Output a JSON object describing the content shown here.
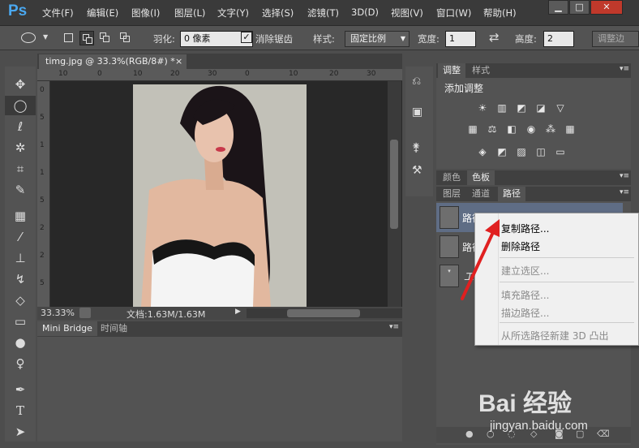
{
  "app": {
    "logo": "Ps"
  },
  "menu": [
    "文件(F)",
    "编辑(E)",
    "图像(I)",
    "图层(L)",
    "文字(Y)",
    "选择(S)",
    "滤镜(T)",
    "3D(D)",
    "视图(V)",
    "窗口(W)",
    "帮助(H)"
  ],
  "window_buttons": {
    "minimize": "▁",
    "restore": "□",
    "close": "✕"
  },
  "options": {
    "feather_label": "羽化:",
    "feather_value": "0 像素",
    "antialias_label": "消除锯齿",
    "style_label": "样式:",
    "style_value": "固定比例",
    "width_label": "宽度:",
    "width_value": "1",
    "height_label": "高度:",
    "height_value": "2",
    "refine_label": "调整边"
  },
  "document": {
    "tab_title": "timg.jpg @ 33.3%(RGB/8#) *",
    "close_glyph": "×",
    "zoom": "33.33%",
    "doc_info": "文档:1.63M/1.63M",
    "ruler_top": [
      "10",
      "0",
      "10",
      "20",
      "30",
      "0",
      "10",
      "20",
      "30"
    ],
    "ruler_left": [
      "0",
      "5",
      "1",
      "1",
      "5",
      "2",
      "2",
      "5"
    ]
  },
  "bottom_panel": {
    "tabs": [
      "Mini Bridge",
      "时间轴"
    ]
  },
  "adjust_panel": {
    "tabs": [
      "调整",
      "样式"
    ],
    "title": "添加调整"
  },
  "color_row": {
    "tabs": [
      "颜色",
      "色板"
    ]
  },
  "paths_panel": {
    "tabs": [
      "图层",
      "通道",
      "路径"
    ],
    "items": [
      "路径 1",
      "路径",
      "工"
    ]
  },
  "context_menu": {
    "items": [
      {
        "label": "复制路径...",
        "enabled": true
      },
      {
        "label": "删除路径",
        "enabled": true
      },
      {
        "label": "建立选区...",
        "enabled": false
      },
      {
        "label": "填充路径...",
        "enabled": false
      },
      {
        "label": "描边路径...",
        "enabled": false
      },
      {
        "label": "从所选路径新建 3D 凸出",
        "enabled": false
      }
    ]
  },
  "watermark": {
    "text": "Bai 经验",
    "url": "jingyan.baidu.com"
  },
  "colors": {
    "accent": "#4aa8f0",
    "annotation_arrow": "#e02020"
  }
}
